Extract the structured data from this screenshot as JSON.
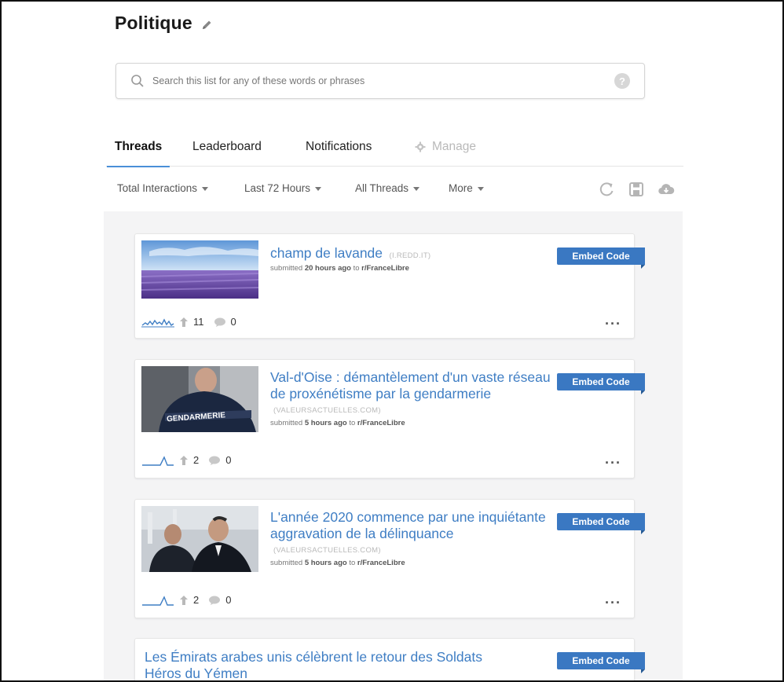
{
  "page": {
    "title": "Politique"
  },
  "search": {
    "placeholder": "Search this list for any of these words or phrases",
    "help_label": "?"
  },
  "tabs": [
    {
      "label": "Threads"
    },
    {
      "label": "Leaderboard"
    },
    {
      "label": "Notifications"
    },
    {
      "label": "Manage"
    }
  ],
  "filters": [
    {
      "label": "Total Interactions"
    },
    {
      "label": "Last 72 Hours"
    },
    {
      "label": "All Threads"
    },
    {
      "label": "More"
    }
  ],
  "actions": {
    "icons": [
      "refresh-icon",
      "save-icon",
      "cloud-download-icon"
    ]
  },
  "colors": {
    "accent": "#3f7ec4",
    "embed": "#3a78c2",
    "feed_bg": "#f4f4f5"
  },
  "posts": [
    {
      "title": "champ de lavande",
      "domain": "(I.REDD.IT)",
      "submitted_prefix": "submitted",
      "age": "20 hours ago",
      "to": "to",
      "subreddit": "r/FranceLibre",
      "upvotes": "11",
      "comments": "0",
      "embed_label": "Embed Code"
    },
    {
      "title": "Val-d'Oise : démantèlement d'un vaste réseau de proxénétisme par la gendarmerie",
      "domain": "(VALEURSACTUELLES.COM)",
      "submitted_prefix": "submitted",
      "age": "5 hours ago",
      "to": "to",
      "subreddit": "r/FranceLibre",
      "upvotes": "2",
      "comments": "0",
      "embed_label": "Embed Code",
      "thumb_text": "GENDARMERIE"
    },
    {
      "title": "L'année 2020 commence par une inquiétante aggravation de la délinquance",
      "domain": "(VALEURSACTUELLES.COM)",
      "submitted_prefix": "submitted",
      "age": "5 hours ago",
      "to": "to",
      "subreddit": "r/FranceLibre",
      "upvotes": "2",
      "comments": "0",
      "embed_label": "Embed Code"
    },
    {
      "title": "Les Émirats arabes unis célèbrent le retour des Soldats Héros du Yémen",
      "embed_label": "Embed Code"
    }
  ]
}
